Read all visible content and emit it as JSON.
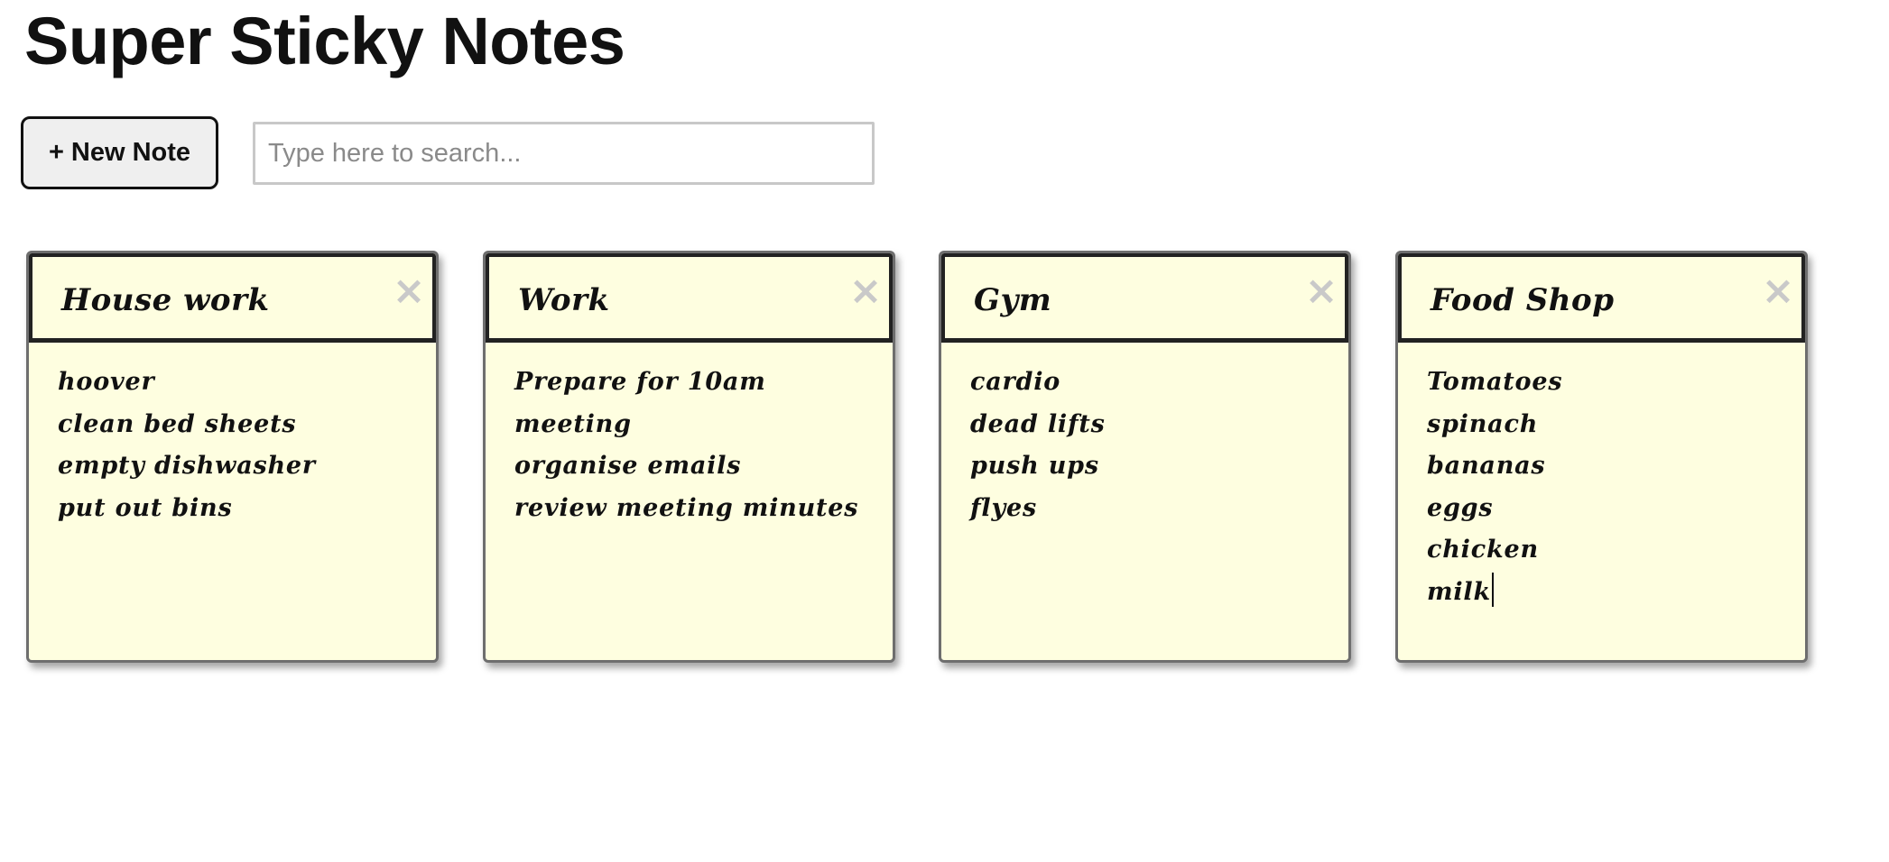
{
  "app": {
    "title": "Super Sticky Notes"
  },
  "toolbar": {
    "new_note_label": "+ New Note",
    "search_placeholder": "Type here to search...",
    "search_value": ""
  },
  "notes": [
    {
      "title": "House work",
      "close_icon": "×",
      "lines": [
        "hoover",
        "clean bed sheets",
        "empty dishwasher",
        "put out bins"
      ]
    },
    {
      "title": "Work",
      "close_icon": "×",
      "lines": [
        "Prepare for 10am",
        "meeting",
        "organise emails",
        "review meeting minutes"
      ]
    },
    {
      "title": "Gym",
      "close_icon": "×",
      "lines": [
        "cardio",
        "dead lifts",
        "push ups",
        "flyes"
      ]
    },
    {
      "title": "Food Shop",
      "close_icon": "×",
      "lines": [
        "Tomatoes",
        "spinach",
        "bananas",
        "eggs",
        "chicken",
        "milk"
      ]
    }
  ],
  "colors": {
    "note_background": "#fefee0",
    "close_icon": "#c9c9c9",
    "button_background": "#efefef"
  }
}
